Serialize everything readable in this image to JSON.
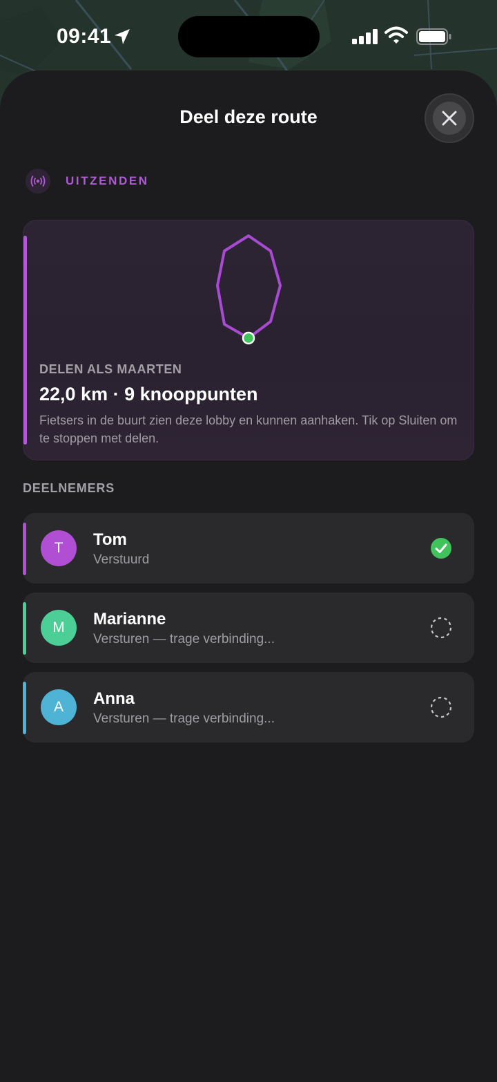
{
  "status_bar": {
    "time": "09:41"
  },
  "sheet": {
    "title": "Deel deze route",
    "close_icon": "close-icon"
  },
  "broadcast": {
    "label": "UITZENDEN",
    "icon": "broadcast-icon"
  },
  "route_card": {
    "share_as": "DELEN ALS MAARTEN",
    "stats": "22,0 km · 9 knooppunten",
    "description": "Fietsers in de buurt zien deze lobby en kunnen aanhaken. Tik op Sluiten om te stoppen met delen."
  },
  "participants": {
    "heading": "DEELNEMERS",
    "items": [
      {
        "initial": "T",
        "name": "Tom",
        "status": "Verstuurd",
        "state": "sent",
        "color": "#b04fd3"
      },
      {
        "initial": "M",
        "name": "Marianne",
        "status": "Versturen — trage verbinding...",
        "state": "pending",
        "color": "#4ccf97"
      },
      {
        "initial": "A",
        "name": "Anna",
        "status": "Versturen — trage verbinding...",
        "state": "pending",
        "color": "#4fb3d6"
      }
    ]
  },
  "colors": {
    "accent": "#b05ad6",
    "success": "#3fc35a",
    "sheet_bg": "#1c1c1e",
    "card_bg": "#2a2a2c"
  }
}
